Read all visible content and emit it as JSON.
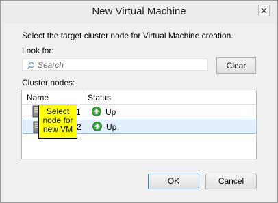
{
  "window": {
    "title": "New Virtual Machine",
    "close_icon": "close-icon"
  },
  "instruction": "Select the target cluster node for Virtual Machine creation.",
  "look_for": {
    "label": "Look for:",
    "placeholder": "Search",
    "value": ""
  },
  "clear_button": "Clear",
  "cluster_nodes": {
    "label": "Cluster nodes:",
    "columns": [
      "Name",
      "Status"
    ],
    "rows": [
      {
        "name_visible": "1",
        "status": "Up",
        "selected": false,
        "icon": "server-icon",
        "status_icon": "up-arrow-icon"
      },
      {
        "name_visible": "2",
        "status": "Up",
        "selected": true,
        "icon": "server-icon",
        "status_icon": "up-arrow-icon"
      }
    ]
  },
  "callout": {
    "lines": [
      "Select",
      "node for",
      "new VM"
    ],
    "color": "#ffff00"
  },
  "buttons": {
    "ok": "OK",
    "cancel": "Cancel"
  },
  "colors": {
    "selection_fill": "#e3effd",
    "selection_border": "#7eb4ea",
    "status_up": "#3aa53a"
  }
}
